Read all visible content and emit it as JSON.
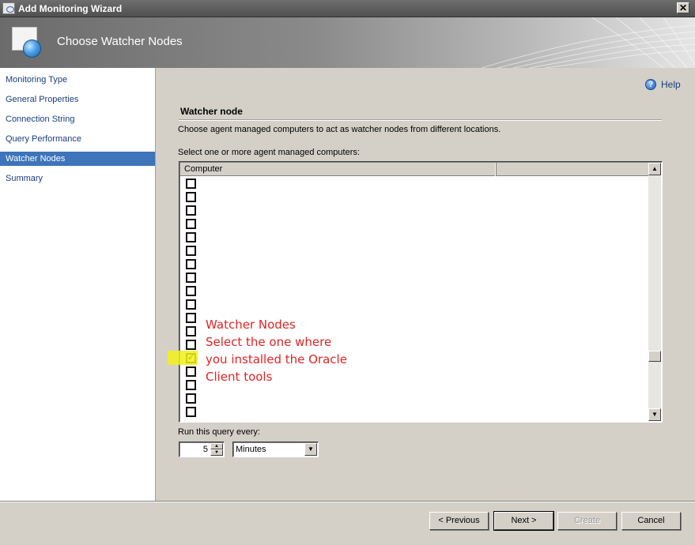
{
  "window": {
    "title": "Add Monitoring Wizard",
    "close_glyph": "✕"
  },
  "banner": {
    "heading": "Choose Watcher Nodes"
  },
  "sidebar": {
    "items": [
      {
        "label": "Monitoring Type"
      },
      {
        "label": "General Properties"
      },
      {
        "label": "Connection String"
      },
      {
        "label": "Query Performance"
      },
      {
        "label": "Watcher Nodes",
        "active": true
      },
      {
        "label": "Summary"
      }
    ]
  },
  "help": {
    "label": "Help",
    "icon": "?"
  },
  "section": {
    "title": "Watcher node",
    "description": "Choose agent managed computers to act as watcher nodes from different locations.",
    "select_label": "Select one or more agent managed computers:"
  },
  "computer_list": {
    "columns": [
      "Computer",
      ""
    ],
    "checked_row_index": 13,
    "row_count": 18,
    "scroll_up_glyph": "▲",
    "scroll_down_glyph": "▼"
  },
  "annotation": {
    "lines": [
      "Watcher Nodes",
      "Select the one where",
      "you installed the Oracle",
      "Client tools"
    ],
    "color": "#e02424",
    "highlight_color": "#f2f11a"
  },
  "schedule": {
    "label": "Run this query every:",
    "interval_value": "5",
    "unit_value": "Minutes"
  },
  "buttons": {
    "previous": "< Previous",
    "next": "Next >",
    "create": "Create",
    "cancel": "Cancel"
  }
}
